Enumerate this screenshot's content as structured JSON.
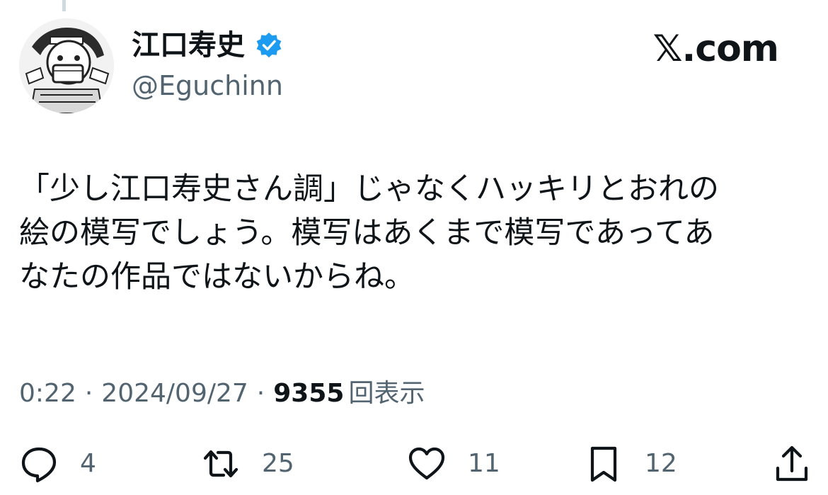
{
  "header": {
    "display_name": "江口寿史",
    "handle": "@Eguchinn",
    "brand": "𝕏.com",
    "colors": {
      "verified": "#1d9bf0",
      "text": "#0f1419",
      "muted": "#536471"
    }
  },
  "tweet": {
    "text": "「少し江口寿史さん調」じゃなくハッキリとおれの\n絵の模写でしょう。模写はあくまで模写であってあ\nなたの作品ではないからね。"
  },
  "meta": {
    "time": "0:22",
    "separator": "·",
    "date": "2024/09/27",
    "views_count": "9355",
    "views_label": "回表示"
  },
  "actions": {
    "reply": {
      "icon": "reply-icon",
      "count": "4"
    },
    "repost": {
      "icon": "repost-icon",
      "count": "25"
    },
    "like": {
      "icon": "heart-icon",
      "count": "11"
    },
    "bookmark": {
      "icon": "bookmark-icon",
      "count": "12"
    },
    "share": {
      "icon": "share-icon"
    }
  }
}
